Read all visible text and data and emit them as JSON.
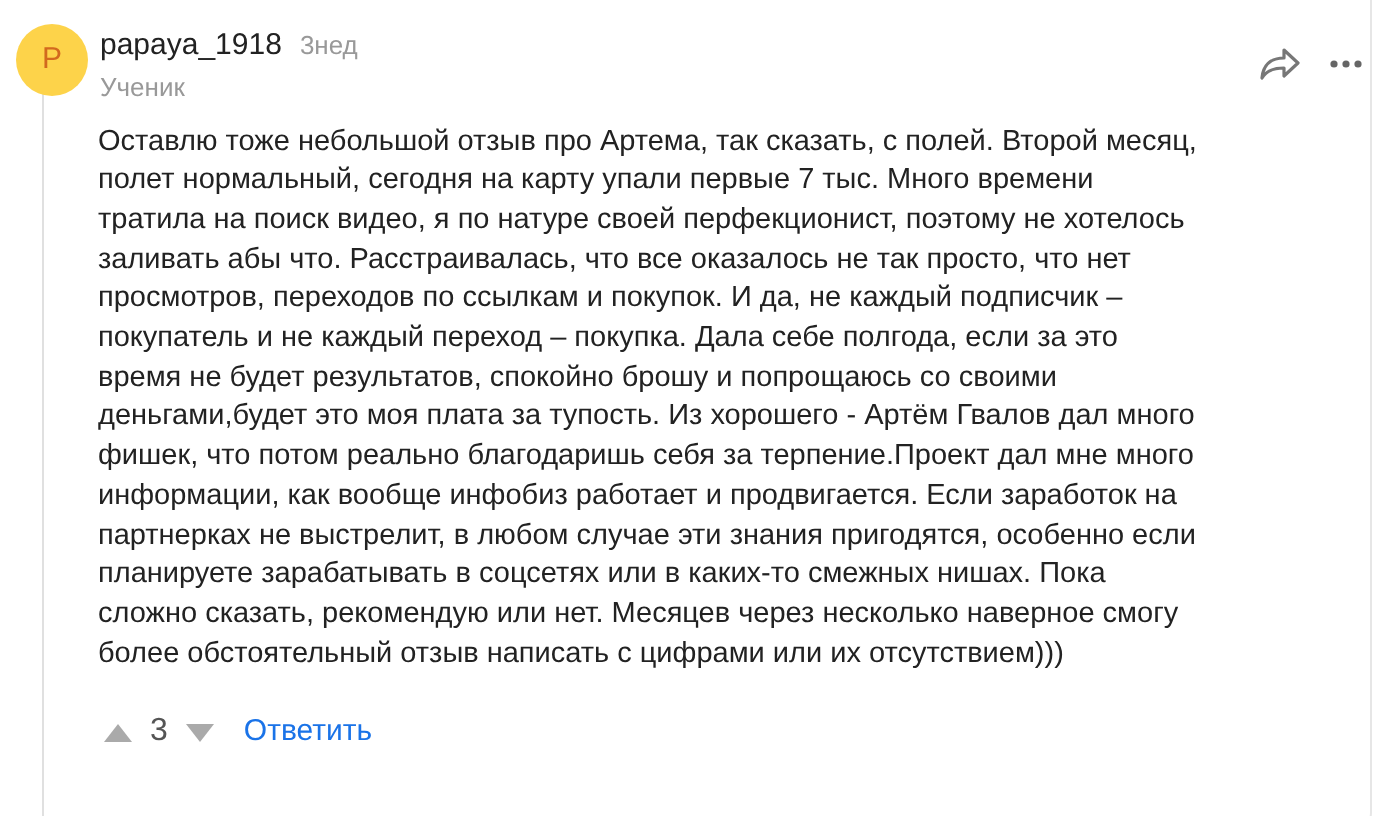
{
  "comment": {
    "avatar_letter": "P",
    "author": "papaya_1918",
    "time": "3нед",
    "role": "Ученик",
    "text_lines": [
      "Оставлю тоже небольшой отзыв про Артема, так сказать, с полей. Второй месяц,",
      "полет нормальный, сегодня на карту упали первые 7 тыс. Много времени",
      "тратила на поиск видео, я по натуре своей перфекционист, поэтому не хотелось",
      "заливать абы что. Расстраивалась, что все оказалось не так просто, что нет",
      "просмотров, переходов по ссылкам и покупок. И да, не каждый подписчик –",
      "покупатель и не каждый переход – покупка. Дала себе полгода, если за это",
      "время не будет результатов, спокойно брошу и попрощаюсь со своими",
      "деньгами,будет это моя плата за тупость. Из хорошего - Артём Гвалов дал много",
      "фишек, что потом реально благодаришь себя за терпение.Проект дал мне много",
      "информации, как вообще инфобиз работает и продвигается. Если заработок на",
      "партнерках не выстрелит, в любом случае эти знания пригодятся, особенно если",
      "планируете зарабатывать в соцсетях или в каких-то смежных нишах. Пока",
      "сложно сказать, рекомендую или нет. Месяцев через несколько наверное смогу",
      "более обстоятельный отзыв написать с цифрами или их отсутствием)))"
    ],
    "votes": "3",
    "reply": "Ответить"
  }
}
